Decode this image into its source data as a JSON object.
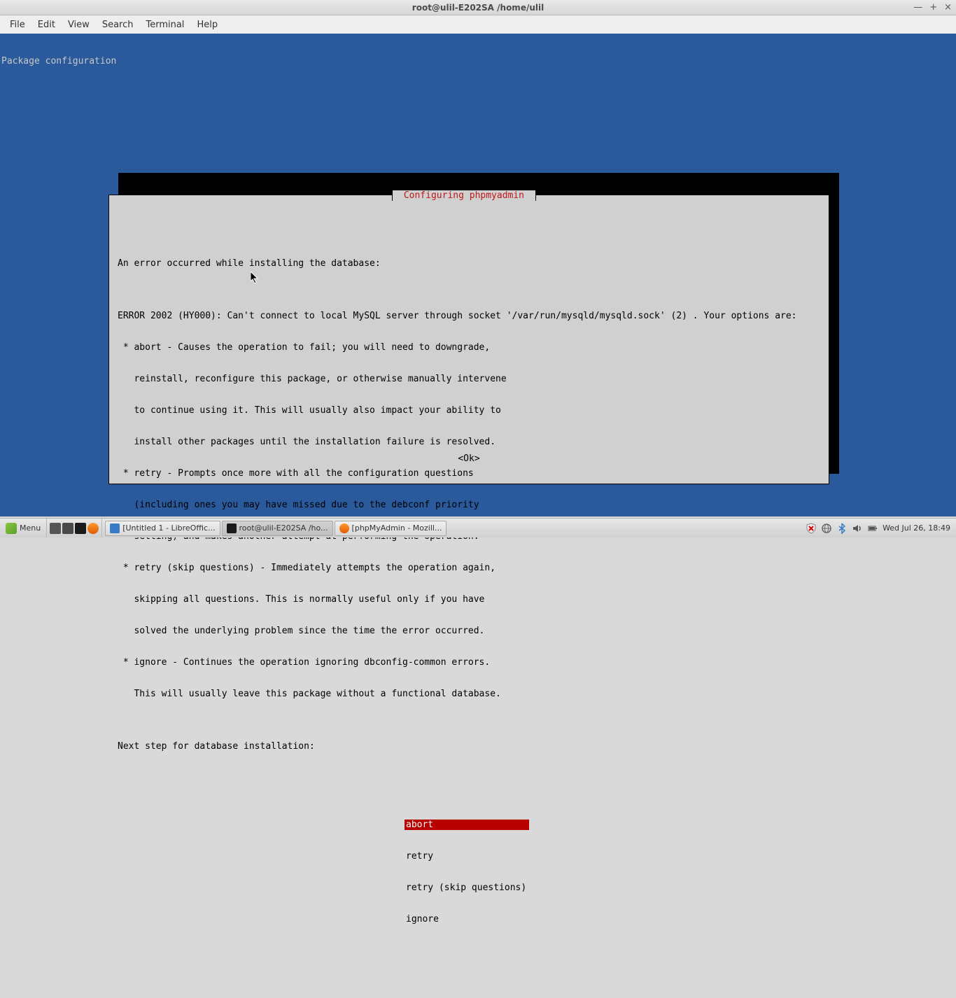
{
  "window": {
    "title": "root@ulil-E202SA /home/ulil",
    "min": "—",
    "max": "+",
    "close": "×"
  },
  "menu": {
    "file": "File",
    "edit": "Edit",
    "view": "View",
    "search": "Search",
    "terminal": "Terminal",
    "help": "Help"
  },
  "terminal": {
    "header": "Package configuration"
  },
  "dialog": {
    "title": " Configuring phpmyadmin ",
    "line1": "An error occurred while installing the database:",
    "line2": "",
    "line3": "ERROR 2002 (HY000): Can't connect to local MySQL server through socket '/var/run/mysqld/mysqld.sock' (2) . Your options are:",
    "line4": " * abort - Causes the operation to fail; you will need to downgrade,",
    "line5": "   reinstall, reconfigure this package, or otherwise manually intervene",
    "line6": "   to continue using it. This will usually also impact your ability to",
    "line7": "   install other packages until the installation failure is resolved.",
    "line8": " * retry - Prompts once more with all the configuration questions",
    "line9": "   (including ones you may have missed due to the debconf priority",
    "line10": "   setting) and makes another attempt at performing the operation.",
    "line11": " * retry (skip questions) - Immediately attempts the operation again,",
    "line12": "   skipping all questions. This is normally useful only if you have",
    "line13": "   solved the underlying problem since the time the error occurred.",
    "line14": " * ignore - Continues the operation ignoring dbconfig-common errors.",
    "line15": "   This will usually leave this package without a functional database.",
    "line16": "",
    "line17": "Next step for database installation:",
    "options": {
      "abort": "abort",
      "retry": "retry",
      "retry_skip": "retry (skip questions)",
      "ignore": "ignore"
    },
    "ok": "<Ok>"
  },
  "taskbar": {
    "menu": "Menu",
    "tasks": {
      "t1": "[Untitled 1 - LibreOffic...",
      "t2": "root@ulil-E202SA /ho...",
      "t3": "[phpMyAdmin - Mozill..."
    },
    "clock": "Wed Jul 26, 18:49"
  },
  "colors": {
    "terminal_bg": "#2a5a9c",
    "dialog_bg": "#d0d0d0",
    "selection": "#b80000",
    "dialog_title": "#c01818"
  }
}
